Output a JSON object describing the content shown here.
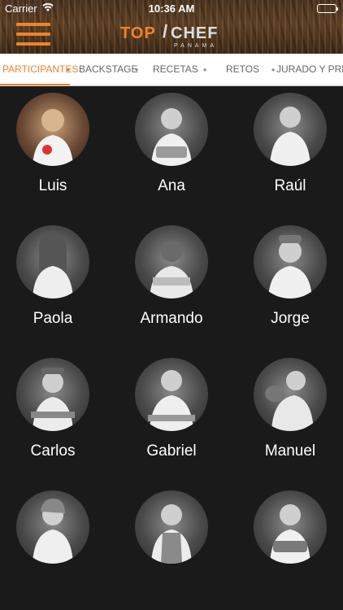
{
  "status": {
    "carrier": "Carrier",
    "time": "10:36 AM"
  },
  "logo": {
    "top": "TOP",
    "chef": "CHEF",
    "country": "PANAMA"
  },
  "tabs": [
    {
      "label": "PARTICIPANTES",
      "active": true
    },
    {
      "label": "BACKSTAGE"
    },
    {
      "label": "RECETAS"
    },
    {
      "label": "RETOS"
    },
    {
      "label": "JURADO Y PRE..."
    }
  ],
  "participants": [
    {
      "name": "Luis"
    },
    {
      "name": "Ana"
    },
    {
      "name": "Raúl"
    },
    {
      "name": "Paola"
    },
    {
      "name": "Armando"
    },
    {
      "name": "Jorge"
    },
    {
      "name": "Carlos"
    },
    {
      "name": "Gabriel"
    },
    {
      "name": "Manuel"
    },
    {
      "name": ""
    },
    {
      "name": ""
    },
    {
      "name": ""
    }
  ],
  "colors": {
    "accent": "#f0822a",
    "background": "#1a1a1a"
  },
  "icons": {
    "menu": "hamburger-menu-icon",
    "wifi": "wifi-icon",
    "battery": "battery-icon"
  }
}
